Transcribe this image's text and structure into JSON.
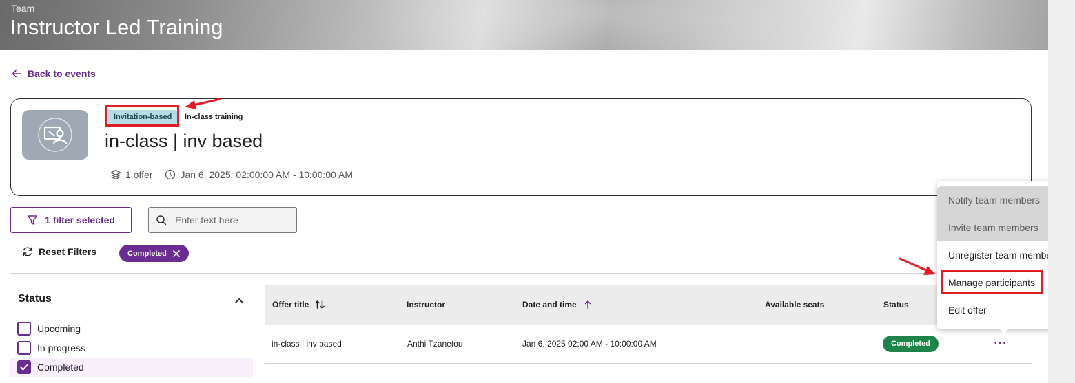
{
  "banner": {
    "section": "Team",
    "title": "Instructor Led Training"
  },
  "nav": {
    "back_label": "Back to events"
  },
  "event": {
    "badge_invitation": "Invitation-based",
    "badge_type": "In-class training",
    "title": "in-class | inv based",
    "offers": "1 offer",
    "datetime": "Jan 6, 2025: 02:00:00 AM - 10:00:00 AM",
    "thumb_icon": "presentation-icon"
  },
  "filters": {
    "filter_button": "1 filter selected",
    "search_placeholder": "Enter text here",
    "reset_label": "Reset Filters",
    "active_chip": "Completed"
  },
  "status_filter": {
    "heading": "Status",
    "options": [
      {
        "label": "Upcoming",
        "checked": false
      },
      {
        "label": "In progress",
        "checked": false
      },
      {
        "label": "Completed",
        "checked": true
      }
    ]
  },
  "table": {
    "headers": [
      "Offer title",
      "Instructor",
      "Date and time",
      "Available seats",
      "Status"
    ],
    "rows": [
      {
        "offer_title": "in-class | inv based",
        "instructor": "Anthi Tzanetou",
        "date_time": "Jan 6, 2025 02:00 AM - 10:00:00 AM",
        "available_seats": "",
        "status": "Completed",
        "more": "···"
      }
    ]
  },
  "context_menu": {
    "items": [
      {
        "label": "Notify team members",
        "disabled": true
      },
      {
        "label": "Invite team members",
        "disabled": true
      },
      {
        "label": "Unregister team members",
        "disabled": false
      },
      {
        "label": "Manage participants",
        "disabled": false
      },
      {
        "label": "Edit offer",
        "disabled": false
      }
    ]
  },
  "colors": {
    "accent": "#6b2c91",
    "completed_status": "#1e8449",
    "invite_badge": "#b6dde4",
    "annotation": "#e01c24"
  }
}
